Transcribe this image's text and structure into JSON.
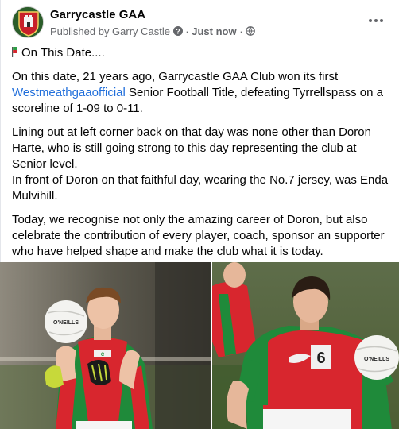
{
  "post": {
    "page_name": "Garrycastle GAA",
    "published_by": "Published by Garry Castle",
    "separator": "·",
    "time": "Just now",
    "title_line": "On This Date....",
    "p1_before": "On this date, 21 years ago, Garrycastle GAA Club won its first ",
    "p1_link": "Westmeathgaaofficial",
    "p1_after": " Senior Football Title, defeating Tyrrellspass on a scoreline of 1-09 to 0-11.",
    "p2_a": "Lining out at left corner back on that day was none other than Doron Harte, who is still going strong to this day representing the club at Senior level.",
    "p2_b": "In front of Doron on that faithful day, wearing the No.7 jersey, was Enda Mulvihill.",
    "p3": "Today, we recognise not only the amazing career of Doron, but  also celebrate the contribution of every player, coach, sponsor an supporter who have helped shape and make the club what it is today."
  },
  "photos": {
    "left_ball_text": "O'NEILLS",
    "right_jersey_number": "6",
    "right_ball_text": "O'NEILLS"
  },
  "icons": {
    "verified": "verified-badge-icon",
    "audience": "globe-icon",
    "more": "more-options-icon",
    "flag": "flag-emoji-icon"
  },
  "colors": {
    "link": "#216fdb",
    "meta": "#65676b",
    "jersey_green": "#1f8a3a",
    "jersey_red": "#d8262e"
  }
}
